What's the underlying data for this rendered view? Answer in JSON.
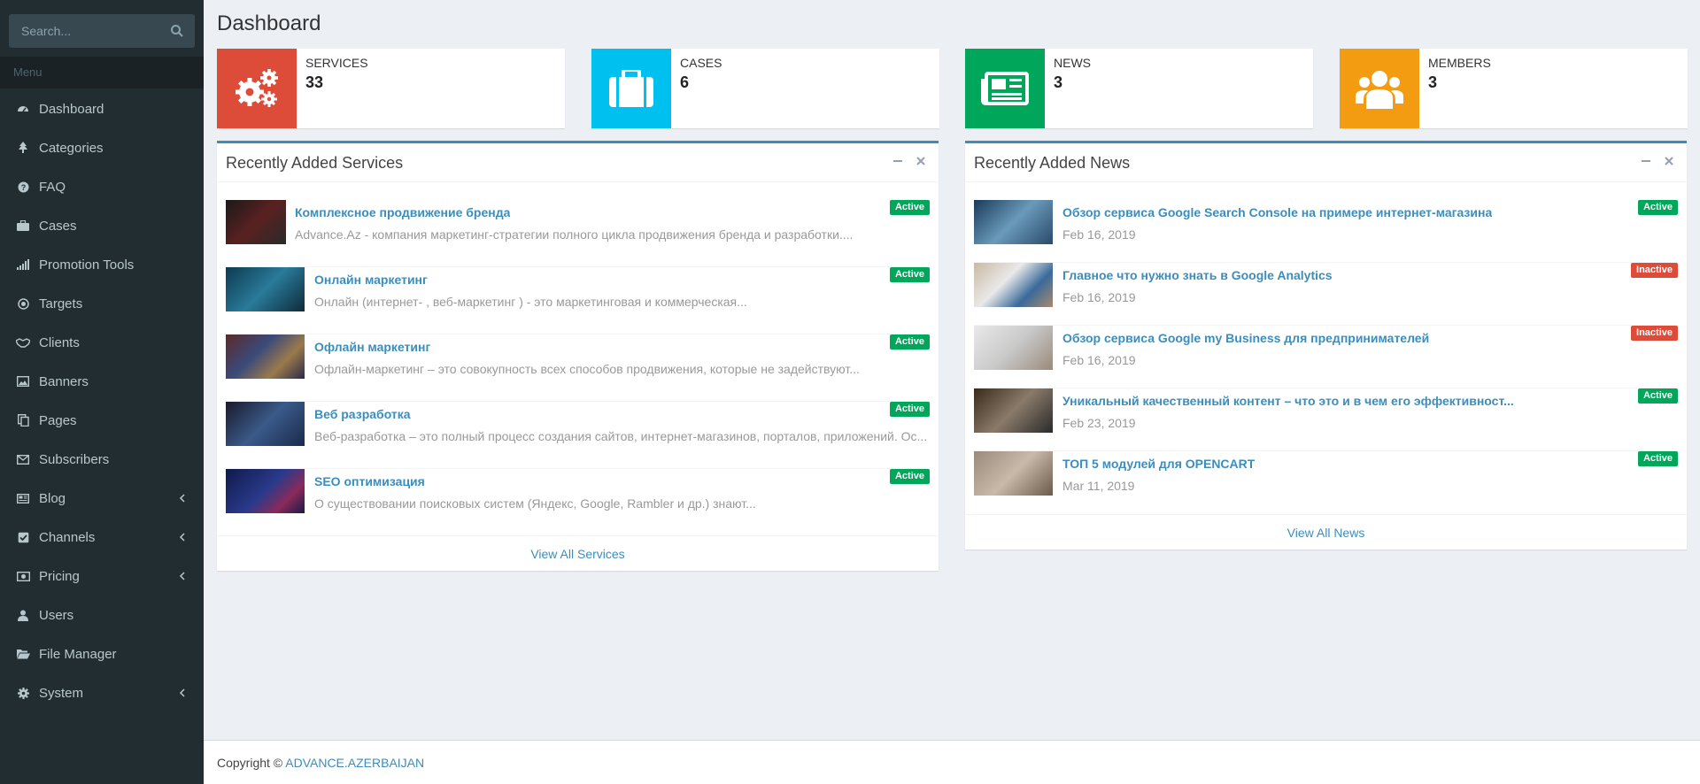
{
  "sidebar": {
    "search_placeholder": "Search...",
    "menu_header": "Menu",
    "items": [
      {
        "label": "Dashboard",
        "icon": "dashboard-icon"
      },
      {
        "label": "Categories",
        "icon": "tree-icon"
      },
      {
        "label": "FAQ",
        "icon": "question-icon"
      },
      {
        "label": "Cases",
        "icon": "briefcase-icon"
      },
      {
        "label": "Promotion Tools",
        "icon": "signal-icon"
      },
      {
        "label": "Targets",
        "icon": "target-icon"
      },
      {
        "label": "Clients",
        "icon": "handshake-icon"
      },
      {
        "label": "Banners",
        "icon": "image-icon"
      },
      {
        "label": "Pages",
        "icon": "copy-icon"
      },
      {
        "label": "Subscribers",
        "icon": "envelope-icon"
      },
      {
        "label": "Blog",
        "icon": "newspaper-icon",
        "has_submenu": true
      },
      {
        "label": "Channels",
        "icon": "check-square-icon",
        "has_submenu": true
      },
      {
        "label": "Pricing",
        "icon": "money-icon",
        "has_submenu": true
      },
      {
        "label": "Users",
        "icon": "user-icon"
      },
      {
        "label": "File Manager",
        "icon": "folder-open-icon"
      },
      {
        "label": "System",
        "icon": "gear-icon",
        "has_submenu": true
      }
    ]
  },
  "page": {
    "title": "Dashboard"
  },
  "info_boxes": [
    {
      "label": "SERVICES",
      "value": "33",
      "color": "#dd4b39",
      "icon": "gears-icon"
    },
    {
      "label": "CASES",
      "value": "6",
      "color": "#00c0ef",
      "icon": "briefcase-icon"
    },
    {
      "label": "NEWS",
      "value": "3",
      "color": "#00a65a",
      "icon": "newspaper-icon"
    },
    {
      "label": "MEMBERS",
      "value": "3",
      "color": "#f39c12",
      "icon": "users-icon"
    }
  ],
  "services_box": {
    "title": "Recently Added Services",
    "footer_link": "View All Services",
    "items": [
      {
        "title": "Комплексное продвижение бренда",
        "desc": "Advance.Az - компания маркетинг-стратегии полного цикла продвижения бренда и разработки....",
        "status": "Active",
        "thumb_color": "#3a2a2a"
      },
      {
        "title": "Онлайн маркетинг",
        "desc": "Онлайн (интернет- , веб-маркетинг ) - это маркетинговая и коммерческая...",
        "status": "Active",
        "thumb_color": "#1d4a63"
      },
      {
        "title": "Офлайн маркетинг",
        "desc": "Офлайн-маркетинг – это совокупность всех способов продвижения, которые не задействуют...",
        "status": "Active",
        "thumb_color": "#4a3a5a"
      },
      {
        "title": "Веб разработка",
        "desc": "Веб-разработка – это полный процесс создания сайтов, интернет-магазинов, порталов, приложений. Ос...",
        "status": "Active",
        "thumb_color": "#2a3a5a"
      },
      {
        "title": "SEO оптимизация",
        "desc": "О существовании поисковых систем (Яндекс, Google, Rambler и др.) знают...",
        "status": "Active",
        "thumb_color": "#1e2a5e"
      }
    ]
  },
  "news_box": {
    "title": "Recently Added News",
    "footer_link": "View All News",
    "items": [
      {
        "title": "Обзор сервиса Google Search Console на примере интернет-магазина",
        "date": "Feb 16, 2019",
        "status": "Active",
        "thumb_color": "#2e5a7a"
      },
      {
        "title": "Главное что нужно знать в Google Analytics",
        "date": "Feb 16, 2019",
        "status": "Inactive",
        "thumb_color": "#b8a892"
      },
      {
        "title": "Обзор сервиса Google my Business для предпринимателей",
        "date": "Feb 16, 2019",
        "status": "Inactive",
        "thumb_color": "#c9c9c9"
      },
      {
        "title": "Уникальный качественный контент – что это и в чем его эффективност...",
        "date": "Feb 23, 2019",
        "status": "Active",
        "thumb_color": "#6a5a4a"
      },
      {
        "title": "ТОП 5 модулей для OPENCART",
        "date": "Mar 11, 2019",
        "status": "Active",
        "thumb_color": "#8a7a6a"
      }
    ]
  },
  "footer": {
    "copyright": "Copyright ©",
    "brand": "ADVANCE.AZERBAIJAN"
  }
}
